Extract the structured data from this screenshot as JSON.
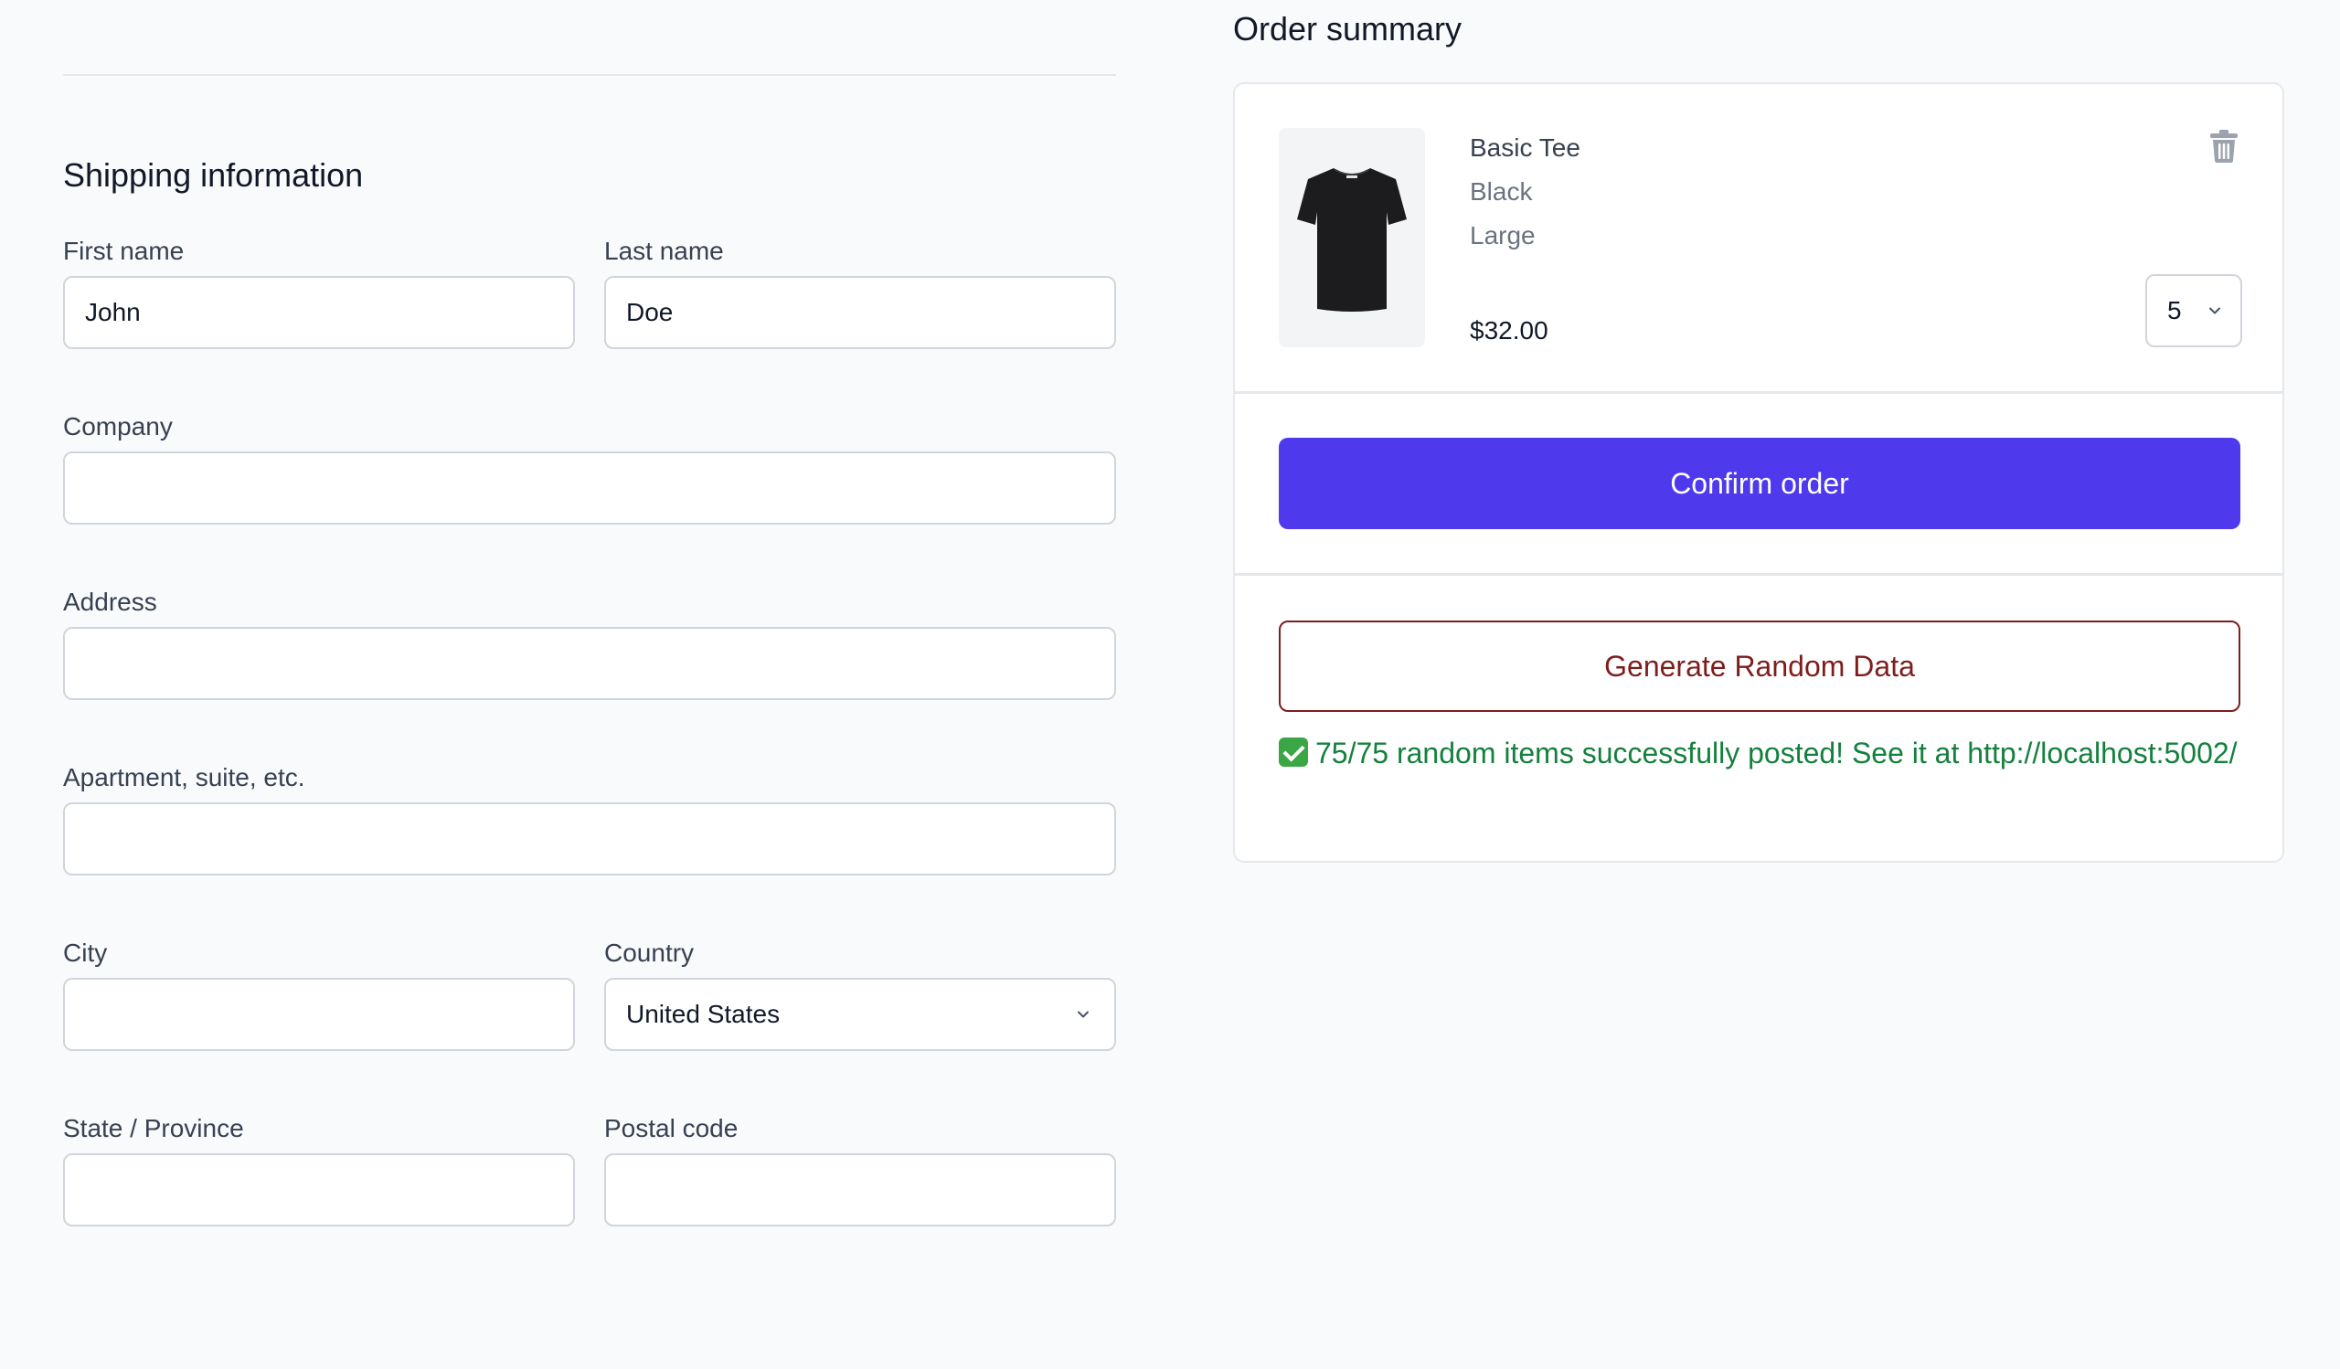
{
  "shipping": {
    "title": "Shipping information",
    "first_name": {
      "label": "First name",
      "value": "John"
    },
    "last_name": {
      "label": "Last name",
      "value": "Doe"
    },
    "company": {
      "label": "Company",
      "value": ""
    },
    "address": {
      "label": "Address",
      "value": ""
    },
    "apartment": {
      "label": "Apartment, suite, etc.",
      "value": ""
    },
    "city": {
      "label": "City",
      "value": ""
    },
    "country": {
      "label": "Country",
      "value": "United States"
    },
    "state": {
      "label": "State / Province",
      "value": ""
    },
    "postal": {
      "label": "Postal code",
      "value": ""
    }
  },
  "summary": {
    "title": "Order summary",
    "item": {
      "name": "Basic Tee",
      "color": "Black",
      "size": "Large",
      "price": "$32.00",
      "quantity": "5"
    },
    "confirm_label": "Confirm order",
    "generate_label": "Generate Random Data",
    "status_text": "75/75 random items successfully posted! See it at http://localhost:5002/"
  },
  "colors": {
    "accent": "#4f39ed",
    "danger": "#7f1d1d",
    "success": "#15803d"
  },
  "icons": [
    "trash-icon",
    "chevron-down-icon",
    "check-icon"
  ]
}
